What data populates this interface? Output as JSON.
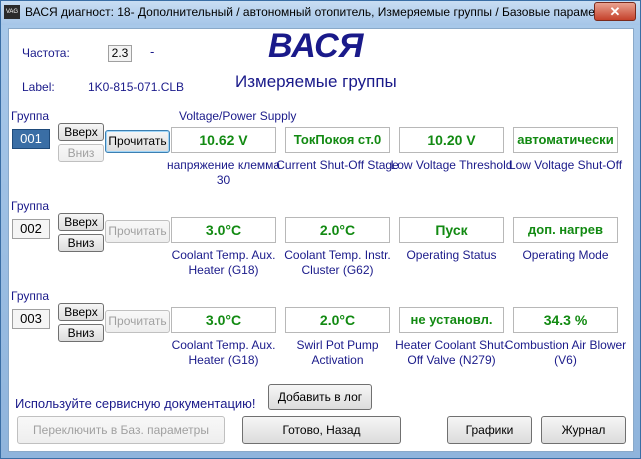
{
  "window": {
    "title": "ВАСЯ диагност: 18- Дополнительный / автономный отопитель,  Измеряемые группы / Базовые параметры",
    "app_icon_text": "VAG",
    "close_glyph": "✕"
  },
  "header": {
    "frequency_label": "Частота:",
    "frequency_value": "2.3",
    "frequency_dash": "-",
    "label_caption": "Label:",
    "label_value": "1K0-815-071.CLB",
    "brand": "ВАСЯ",
    "subtitle": "Измеряемые группы"
  },
  "groups": [
    {
      "caption": "Группа",
      "number": "001",
      "up": "Вверх",
      "down": "Вниз",
      "read": "Прочитать",
      "heading": "Voltage/Power Supply",
      "fields": [
        {
          "value": "10.62 V",
          "label": "напряжение клемма 30"
        },
        {
          "value": "ТокПокоя ст.0",
          "label": "Current Shut-Off Stage"
        },
        {
          "value": "10.20 V",
          "label": "Low Voltage Threshold"
        },
        {
          "value": "автоматически",
          "label": "Low Voltage Shut-Off"
        }
      ]
    },
    {
      "caption": "Группа",
      "number": "002",
      "up": "Вверх",
      "down": "Вниз",
      "read": "Прочитать",
      "fields": [
        {
          "value": "3.0°C",
          "label": "Coolant Temp. Aux. Heater (G18)"
        },
        {
          "value": "2.0°C",
          "label": "Coolant Temp. Instr. Cluster (G62)"
        },
        {
          "value": "Пуск",
          "label": "Operating Status"
        },
        {
          "value": "доп. нагрев",
          "label": "Operating Mode"
        }
      ]
    },
    {
      "caption": "Группа",
      "number": "003",
      "up": "Вверх",
      "down": "Вниз",
      "read": "Прочитать",
      "fields": [
        {
          "value": "3.0°C",
          "label": "Coolant Temp. Aux. Heater (G18)"
        },
        {
          "value": "2.0°C",
          "label": "Swirl Pot Pump Activation"
        },
        {
          "value": "не установл.",
          "label": "Heater Coolant Shut-Off Valve (N279)"
        },
        {
          "value": "34.3 %",
          "label": "Combustion Air Blower (V6)"
        }
      ]
    }
  ],
  "footer": {
    "service_note": "Используйте сервисную документацию!",
    "add_log": "Добавить в лог",
    "switch_basic": "Переключить в Баз. параметры",
    "done_back": "Готово, Назад",
    "graphs": "Графики",
    "journal": "Журнал"
  }
}
